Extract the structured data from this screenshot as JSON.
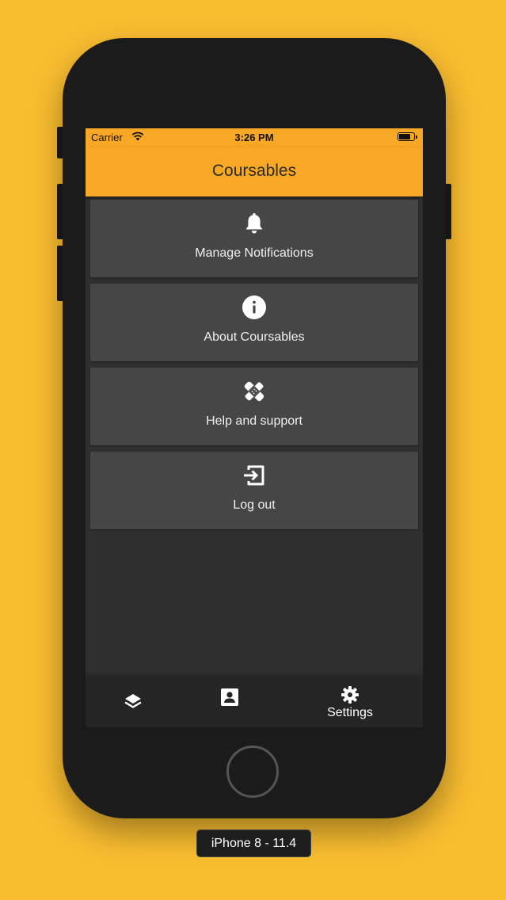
{
  "status_bar": {
    "carrier": "Carrier",
    "time": "3:26 PM",
    "battery_level": 0.75
  },
  "app": {
    "title": "Coursables",
    "accent_color": "#F9A825"
  },
  "menu": {
    "items": [
      {
        "label": "Manage Notifications",
        "icon": "bell-icon"
      },
      {
        "label": "About Coursables",
        "icon": "info-icon"
      },
      {
        "label": "Help and support",
        "icon": "bandage-icon"
      },
      {
        "label": "Log out",
        "icon": "exit-icon"
      }
    ]
  },
  "tabbar": {
    "tabs": [
      {
        "icon": "layers-icon",
        "label": ""
      },
      {
        "icon": "contact-card-icon",
        "label": ""
      },
      {
        "icon": "gear-icon",
        "label": "Settings"
      }
    ]
  },
  "device": {
    "label": "iPhone 8 - 11.4"
  }
}
